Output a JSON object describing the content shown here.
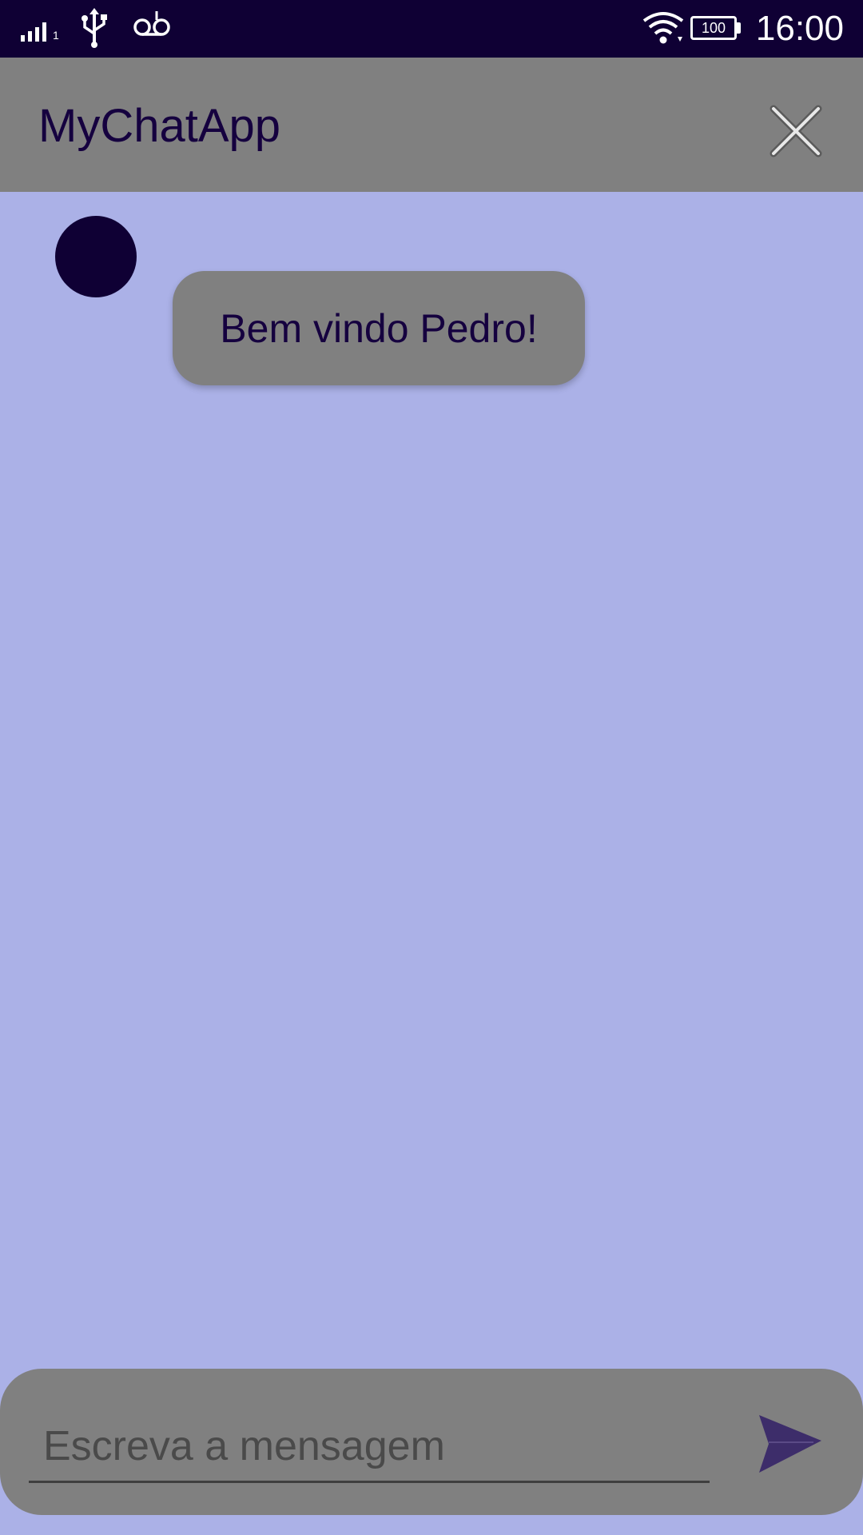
{
  "status_bar": {
    "time": "16:00",
    "battery": "100",
    "sim_slot": "1",
    "icons": [
      "signal-icon",
      "usb-icon",
      "voicemail-icon",
      "wifi-icon",
      "battery-icon"
    ]
  },
  "app_bar": {
    "title": "MyChatApp",
    "close_icon": "close-icon"
  },
  "messages": [
    {
      "text": "Bem vindo Pedro!",
      "avatar": "avatar"
    }
  ],
  "composer": {
    "placeholder": "Escreva a mensagem",
    "value": "",
    "send_icon": "send-icon"
  },
  "colors": {
    "status_bar_bg": "#0f0034",
    "app_bar_bg": "#808080",
    "chat_bg": "#abb1e7",
    "avatar": "#0f0034",
    "text_dark": "#15003f",
    "send_icon": "#3d2d6a"
  }
}
